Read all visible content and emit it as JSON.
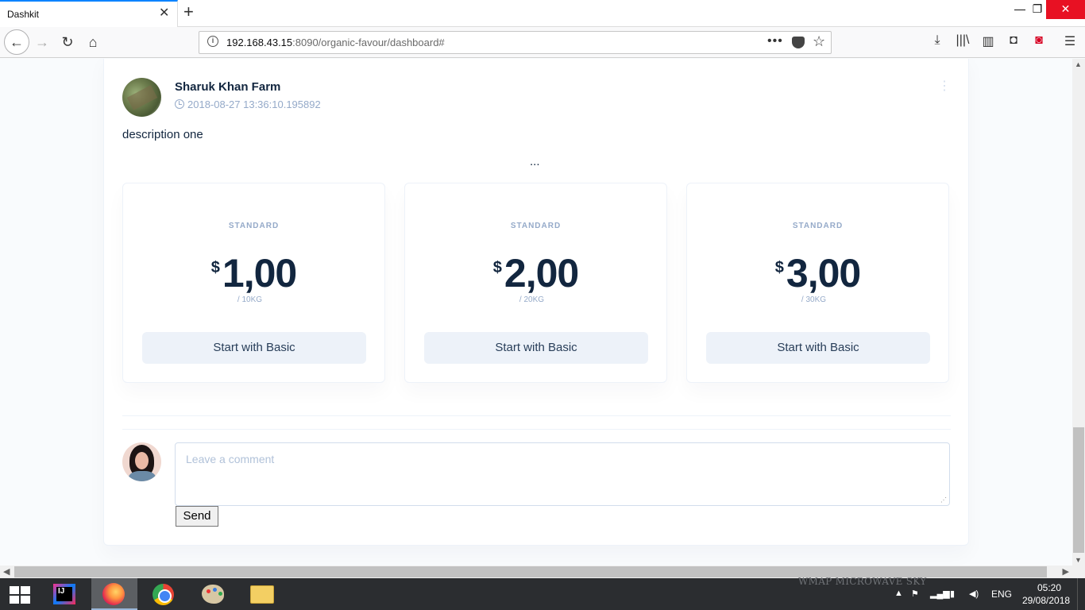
{
  "browser": {
    "tab_title": "Dashkit",
    "tab_close": "✕",
    "new_tab": "+",
    "window": {
      "minimize": "—",
      "maximize": "❐",
      "close": "✕"
    },
    "nav": {
      "back": "←",
      "forward": "→",
      "reload": "↻",
      "home": "⌂"
    },
    "url_host": "192.168.43.15",
    "url_rest": ":8090/organic-favour/dashboard#",
    "url_more": "•••",
    "url_star": "☆",
    "toolbar": {
      "download": "⤓",
      "library": "|||\\",
      "sidebar": "▥",
      "pocket": "◘",
      "extension": "◙",
      "menu": "☰"
    }
  },
  "post": {
    "author": "Sharuk Khan Farm",
    "timestamp": "2018-08-27 13:36:10.195892",
    "menu_glyph": "⋮",
    "description": "description one",
    "ellipsis": "..."
  },
  "pricing": [
    {
      "plan": "STANDARD",
      "currency": "$",
      "amount": "1,00",
      "unit": "/ 10KG",
      "button": "Start with Basic"
    },
    {
      "plan": "STANDARD",
      "currency": "$",
      "amount": "2,00",
      "unit": "/ 20KG",
      "button": "Start with Basic"
    },
    {
      "plan": "STANDARD",
      "currency": "$",
      "amount": "3,00",
      "unit": "/ 30KG",
      "button": "Start with Basic"
    }
  ],
  "comment": {
    "placeholder": "Leave a comment",
    "send": "Send"
  },
  "scroll": {
    "up": "▲",
    "down": "▼",
    "left": "◀",
    "right": "▶"
  },
  "taskbar": {
    "watermark": "WMAP MICROWAVE SKY",
    "ij_label": "IJ",
    "tray_caret": "▲",
    "tray_flag": "⚑",
    "tray_net": "▂▄▆",
    "tray_battery": "▮",
    "tray_volume": "◀)",
    "language": "ENG",
    "time": "05:20",
    "date": "29/08/2018"
  },
  "colors": {
    "accent": "#0a84ff",
    "text_primary": "#12263f",
    "text_muted": "#95aac9",
    "button_bg": "#edf2f9",
    "taskbar_bg": "#2b2d30",
    "close_red": "#e81123"
  }
}
